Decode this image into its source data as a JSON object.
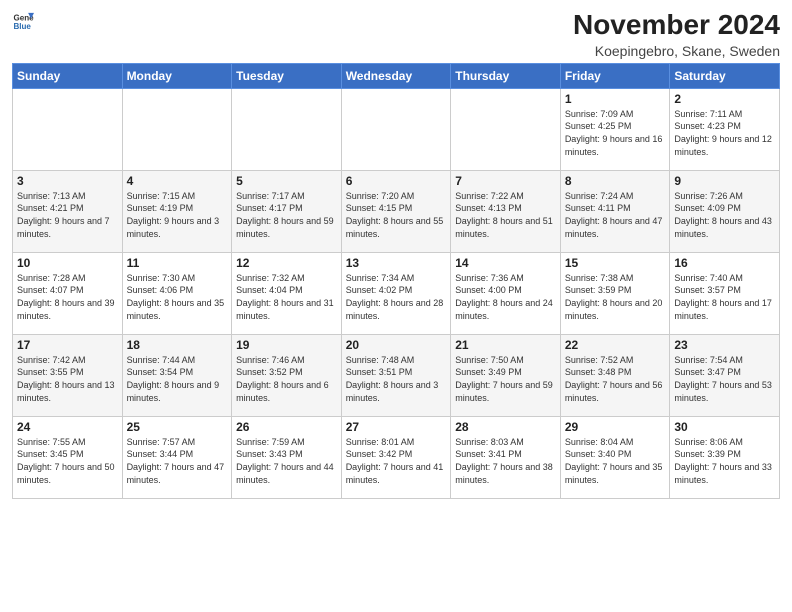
{
  "logo": {
    "general": "General",
    "blue": "Blue"
  },
  "title": "November 2024",
  "location": "Koepingebro, Skane, Sweden",
  "headers": [
    "Sunday",
    "Monday",
    "Tuesday",
    "Wednesday",
    "Thursday",
    "Friday",
    "Saturday"
  ],
  "weeks": [
    [
      {
        "day": "",
        "detail": ""
      },
      {
        "day": "",
        "detail": ""
      },
      {
        "day": "",
        "detail": ""
      },
      {
        "day": "",
        "detail": ""
      },
      {
        "day": "",
        "detail": ""
      },
      {
        "day": "1",
        "detail": "Sunrise: 7:09 AM\nSunset: 4:25 PM\nDaylight: 9 hours and 16 minutes."
      },
      {
        "day": "2",
        "detail": "Sunrise: 7:11 AM\nSunset: 4:23 PM\nDaylight: 9 hours and 12 minutes."
      }
    ],
    [
      {
        "day": "3",
        "detail": "Sunrise: 7:13 AM\nSunset: 4:21 PM\nDaylight: 9 hours and 7 minutes."
      },
      {
        "day": "4",
        "detail": "Sunrise: 7:15 AM\nSunset: 4:19 PM\nDaylight: 9 hours and 3 minutes."
      },
      {
        "day": "5",
        "detail": "Sunrise: 7:17 AM\nSunset: 4:17 PM\nDaylight: 8 hours and 59 minutes."
      },
      {
        "day": "6",
        "detail": "Sunrise: 7:20 AM\nSunset: 4:15 PM\nDaylight: 8 hours and 55 minutes."
      },
      {
        "day": "7",
        "detail": "Sunrise: 7:22 AM\nSunset: 4:13 PM\nDaylight: 8 hours and 51 minutes."
      },
      {
        "day": "8",
        "detail": "Sunrise: 7:24 AM\nSunset: 4:11 PM\nDaylight: 8 hours and 47 minutes."
      },
      {
        "day": "9",
        "detail": "Sunrise: 7:26 AM\nSunset: 4:09 PM\nDaylight: 8 hours and 43 minutes."
      }
    ],
    [
      {
        "day": "10",
        "detail": "Sunrise: 7:28 AM\nSunset: 4:07 PM\nDaylight: 8 hours and 39 minutes."
      },
      {
        "day": "11",
        "detail": "Sunrise: 7:30 AM\nSunset: 4:06 PM\nDaylight: 8 hours and 35 minutes."
      },
      {
        "day": "12",
        "detail": "Sunrise: 7:32 AM\nSunset: 4:04 PM\nDaylight: 8 hours and 31 minutes."
      },
      {
        "day": "13",
        "detail": "Sunrise: 7:34 AM\nSunset: 4:02 PM\nDaylight: 8 hours and 28 minutes."
      },
      {
        "day": "14",
        "detail": "Sunrise: 7:36 AM\nSunset: 4:00 PM\nDaylight: 8 hours and 24 minutes."
      },
      {
        "day": "15",
        "detail": "Sunrise: 7:38 AM\nSunset: 3:59 PM\nDaylight: 8 hours and 20 minutes."
      },
      {
        "day": "16",
        "detail": "Sunrise: 7:40 AM\nSunset: 3:57 PM\nDaylight: 8 hours and 17 minutes."
      }
    ],
    [
      {
        "day": "17",
        "detail": "Sunrise: 7:42 AM\nSunset: 3:55 PM\nDaylight: 8 hours and 13 minutes."
      },
      {
        "day": "18",
        "detail": "Sunrise: 7:44 AM\nSunset: 3:54 PM\nDaylight: 8 hours and 9 minutes."
      },
      {
        "day": "19",
        "detail": "Sunrise: 7:46 AM\nSunset: 3:52 PM\nDaylight: 8 hours and 6 minutes."
      },
      {
        "day": "20",
        "detail": "Sunrise: 7:48 AM\nSunset: 3:51 PM\nDaylight: 8 hours and 3 minutes."
      },
      {
        "day": "21",
        "detail": "Sunrise: 7:50 AM\nSunset: 3:49 PM\nDaylight: 7 hours and 59 minutes."
      },
      {
        "day": "22",
        "detail": "Sunrise: 7:52 AM\nSunset: 3:48 PM\nDaylight: 7 hours and 56 minutes."
      },
      {
        "day": "23",
        "detail": "Sunrise: 7:54 AM\nSunset: 3:47 PM\nDaylight: 7 hours and 53 minutes."
      }
    ],
    [
      {
        "day": "24",
        "detail": "Sunrise: 7:55 AM\nSunset: 3:45 PM\nDaylight: 7 hours and 50 minutes."
      },
      {
        "day": "25",
        "detail": "Sunrise: 7:57 AM\nSunset: 3:44 PM\nDaylight: 7 hours and 47 minutes."
      },
      {
        "day": "26",
        "detail": "Sunrise: 7:59 AM\nSunset: 3:43 PM\nDaylight: 7 hours and 44 minutes."
      },
      {
        "day": "27",
        "detail": "Sunrise: 8:01 AM\nSunset: 3:42 PM\nDaylight: 7 hours and 41 minutes."
      },
      {
        "day": "28",
        "detail": "Sunrise: 8:03 AM\nSunset: 3:41 PM\nDaylight: 7 hours and 38 minutes."
      },
      {
        "day": "29",
        "detail": "Sunrise: 8:04 AM\nSunset: 3:40 PM\nDaylight: 7 hours and 35 minutes."
      },
      {
        "day": "30",
        "detail": "Sunrise: 8:06 AM\nSunset: 3:39 PM\nDaylight: 7 hours and 33 minutes."
      }
    ]
  ]
}
